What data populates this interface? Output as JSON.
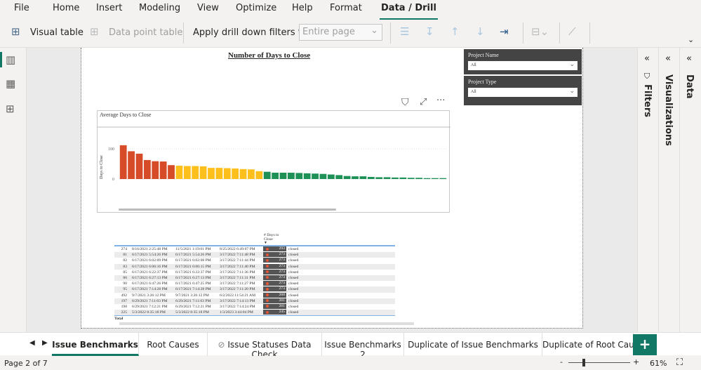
{
  "menu": {
    "tabs": [
      "File",
      "Home",
      "Insert",
      "Modeling",
      "View",
      "Optimize",
      "Help",
      "Format",
      "Data / Drill"
    ],
    "active": "Data / Drill"
  },
  "ribbon": {
    "visual_table": "Visual table",
    "data_point_table": "Data point table",
    "apply_drill": "Apply drill down filters to",
    "drill_scope": "Entire page"
  },
  "report": {
    "title": "Number of Days to Close",
    "slicers": [
      {
        "label": "Project Name",
        "value": "All"
      },
      {
        "label": "Project Type",
        "value": "All"
      }
    ]
  },
  "chart_data": {
    "type": "bar",
    "title": "Average Days to Close",
    "ylabel": "Days to Close",
    "ylim": [
      0,
      140
    ],
    "yticks": [
      0,
      100
    ],
    "values": [
      112,
      92,
      84,
      63,
      59,
      58,
      46,
      44,
      43,
      43,
      42,
      37,
      37,
      36,
      35,
      33,
      32,
      26,
      24,
      21,
      21,
      21,
      20,
      19,
      18,
      17,
      15,
      13,
      10,
      9,
      9,
      7,
      6,
      6,
      5,
      5,
      4,
      4,
      3,
      3,
      3
    ],
    "colors": {
      "red": "#d64b28",
      "yellow": "#fdbf1c",
      "green": "#1e9157"
    },
    "thresholds": {
      "red_min": 45,
      "yellow_min": 25
    }
  },
  "table": {
    "header": "# Days to Close",
    "total_label": "Total",
    "rows": [
      [
        "274",
        "8/16/2021 2:25:48 PM",
        "11/5/2021 1:19:01 PM",
        "8/25/2022 6:49:07 PM",
        "293",
        "closed"
      ],
      [
        "81",
        "6/17/2021 5:54:26 PM",
        "6/17/2021 5:54:26 PM",
        "3/17/2022 7:11:48 PM",
        "273",
        "closed"
      ],
      [
        "82",
        "6/17/2021 6:02:09 PM",
        "6/17/2021 6:02:08 PM",
        "3/17/2022 7:11:44 PM",
        "273",
        "closed"
      ],
      [
        "83",
        "6/17/2021 6:06:16 PM",
        "6/17/2021 6:06:15 PM",
        "3/17/2022 7:11:40 PM",
        "273",
        "closed"
      ],
      [
        "85",
        "6/17/2021 6:22:37 PM",
        "6/17/2021 6:22:37 PM",
        "3/17/2022 7:11:36 PM",
        "273",
        "closed"
      ],
      [
        "86",
        "6/17/2021 6:27:13 PM",
        "6/17/2021 6:27:13 PM",
        "3/17/2022 7:11:31 PM",
        "273",
        "closed"
      ],
      [
        "90",
        "6/17/2021 6:47:26 PM",
        "6/17/2021 6:47:25 PM",
        "3/17/2022 7:11:27 PM",
        "273",
        "closed"
      ],
      [
        "95",
        "6/17/2021 7:14:28 PM",
        "6/17/2021 7:14:28 PM",
        "3/17/2022 7:11:20 PM",
        "273",
        "closed"
      ],
      [
        "492",
        "9/7/2021 3:26:12 PM",
        "9/7/2021 3:26:12 PM",
        "6/2/2022 11:54:21 AM",
        "268",
        "closed"
      ],
      [
        "197",
        "6/29/2021 7:11:03 PM",
        "6/29/2021 7:11:03 PM",
        "3/17/2022 7:14:13 PM",
        "261",
        "closed"
      ],
      [
        "198",
        "6/29/2021 7:12:21 PM",
        "6/29/2021 7:12:21 PM",
        "3/17/2022 7:14:24 PM",
        "261",
        "closed"
      ],
      [
        "225",
        "5/3/2022 8:35:18 PM",
        "5/3/2022 8:35:18 PM",
        "1/3/2023 3:44:04 PM",
        "245",
        "closed"
      ]
    ]
  },
  "panes": {
    "filters": "Filters",
    "visualizations": "Visualizations",
    "data": "Data"
  },
  "page_tabs": [
    "Issue Benchmarks",
    "Root Causes",
    "Issue Statuses Data Check",
    "Issue Benchmarks 2",
    "Duplicate of Issue Benchmarks",
    "Duplicate of Root Caus"
  ],
  "active_page": "Issue Benchmarks",
  "status": {
    "page": "Page 2 of 7",
    "zoom": "61%"
  }
}
